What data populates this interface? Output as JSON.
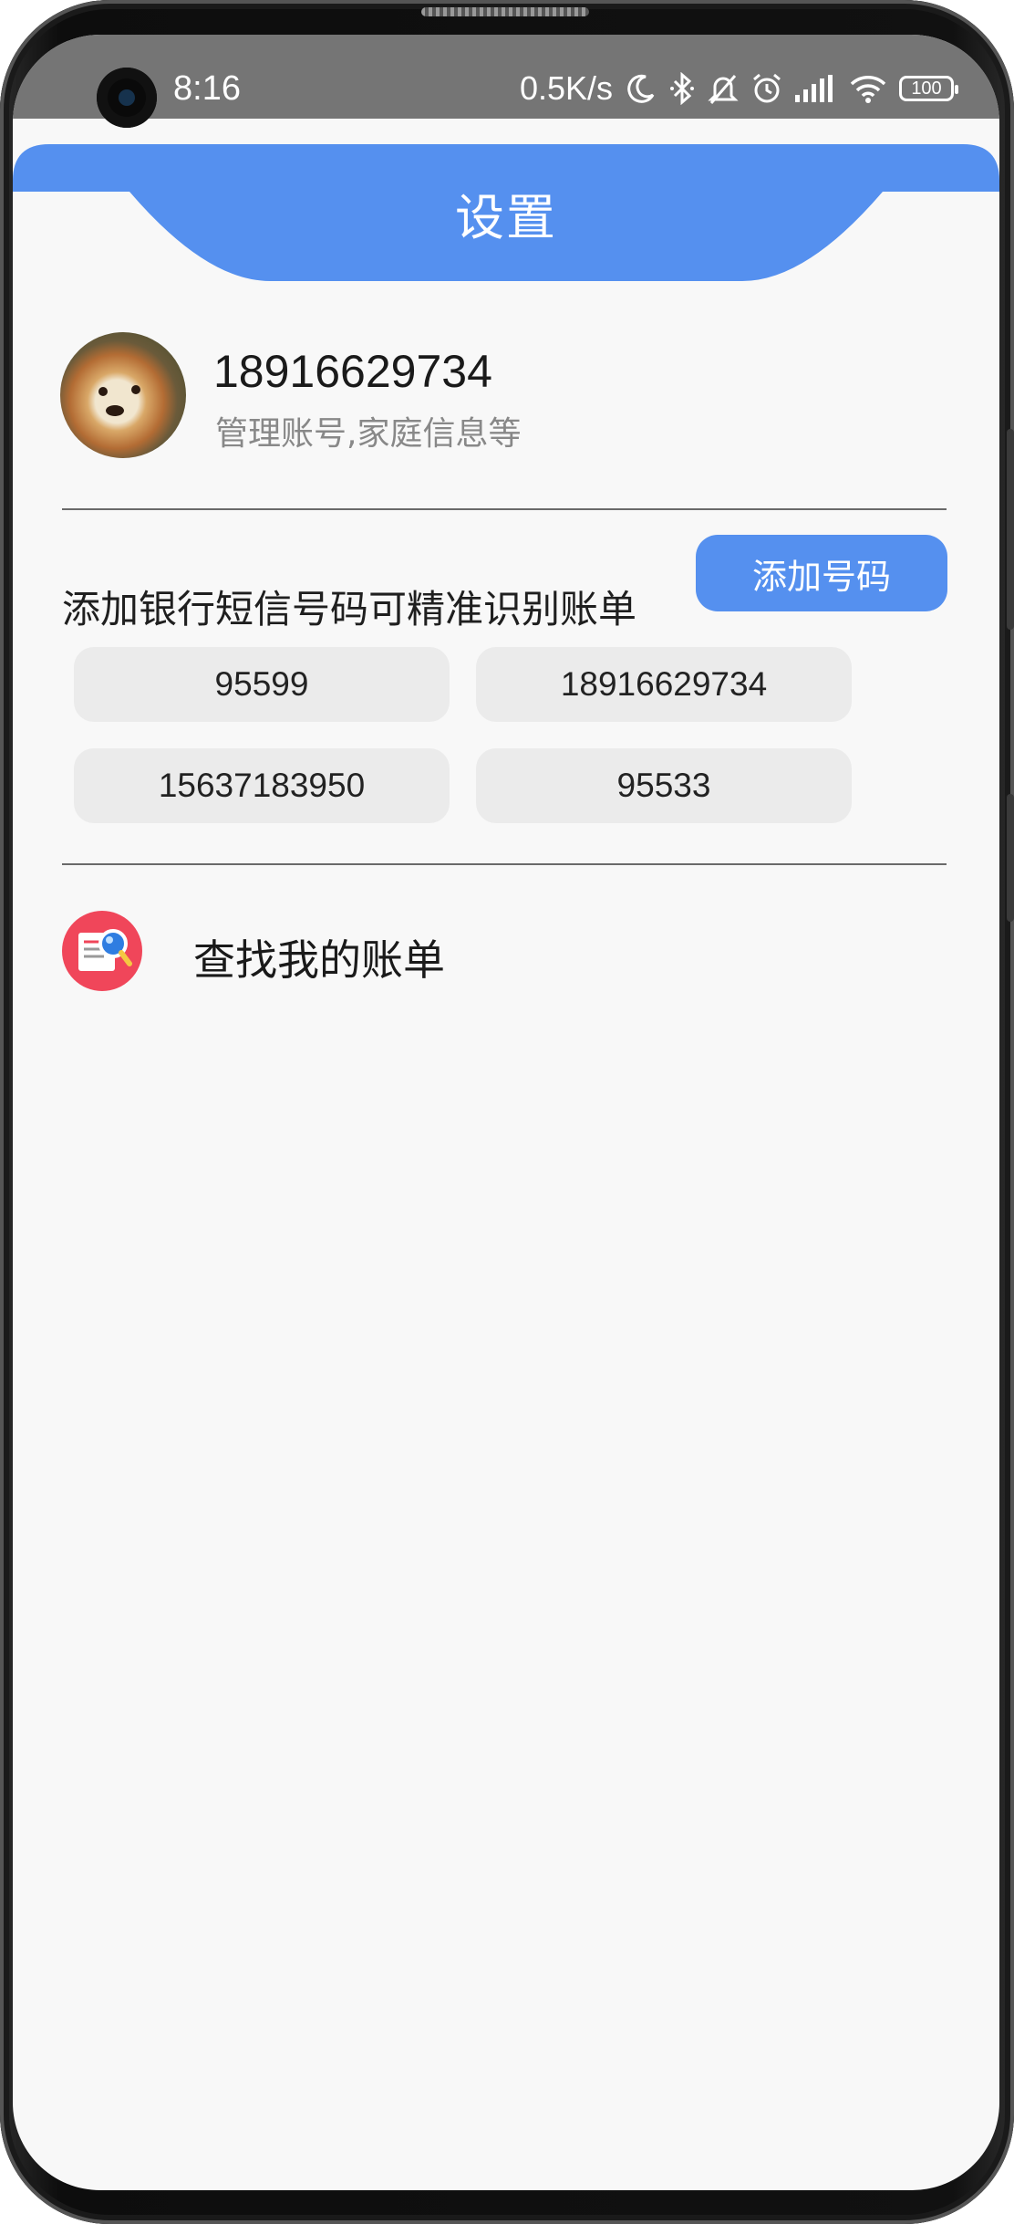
{
  "status_bar": {
    "time": "8:16",
    "net_speed": "0.5K/s",
    "battery": "100",
    "icons": [
      "moon-icon",
      "bluetooth-icon",
      "bell-off-icon",
      "alarm-icon",
      "signal-icon",
      "wifi-icon",
      "battery-icon"
    ]
  },
  "header": {
    "title": "设置",
    "color": "#5590ef"
  },
  "profile": {
    "phone": "18916629734",
    "subtitle": "管理账号,家庭信息等"
  },
  "bank_numbers": {
    "hint": "添加银行短信号码可精准识别账单",
    "add_button": "添加号码",
    "numbers": [
      "95599",
      "18916629734",
      "15637183950",
      "95533"
    ]
  },
  "menu": {
    "find_bills": "查找我的账单"
  }
}
